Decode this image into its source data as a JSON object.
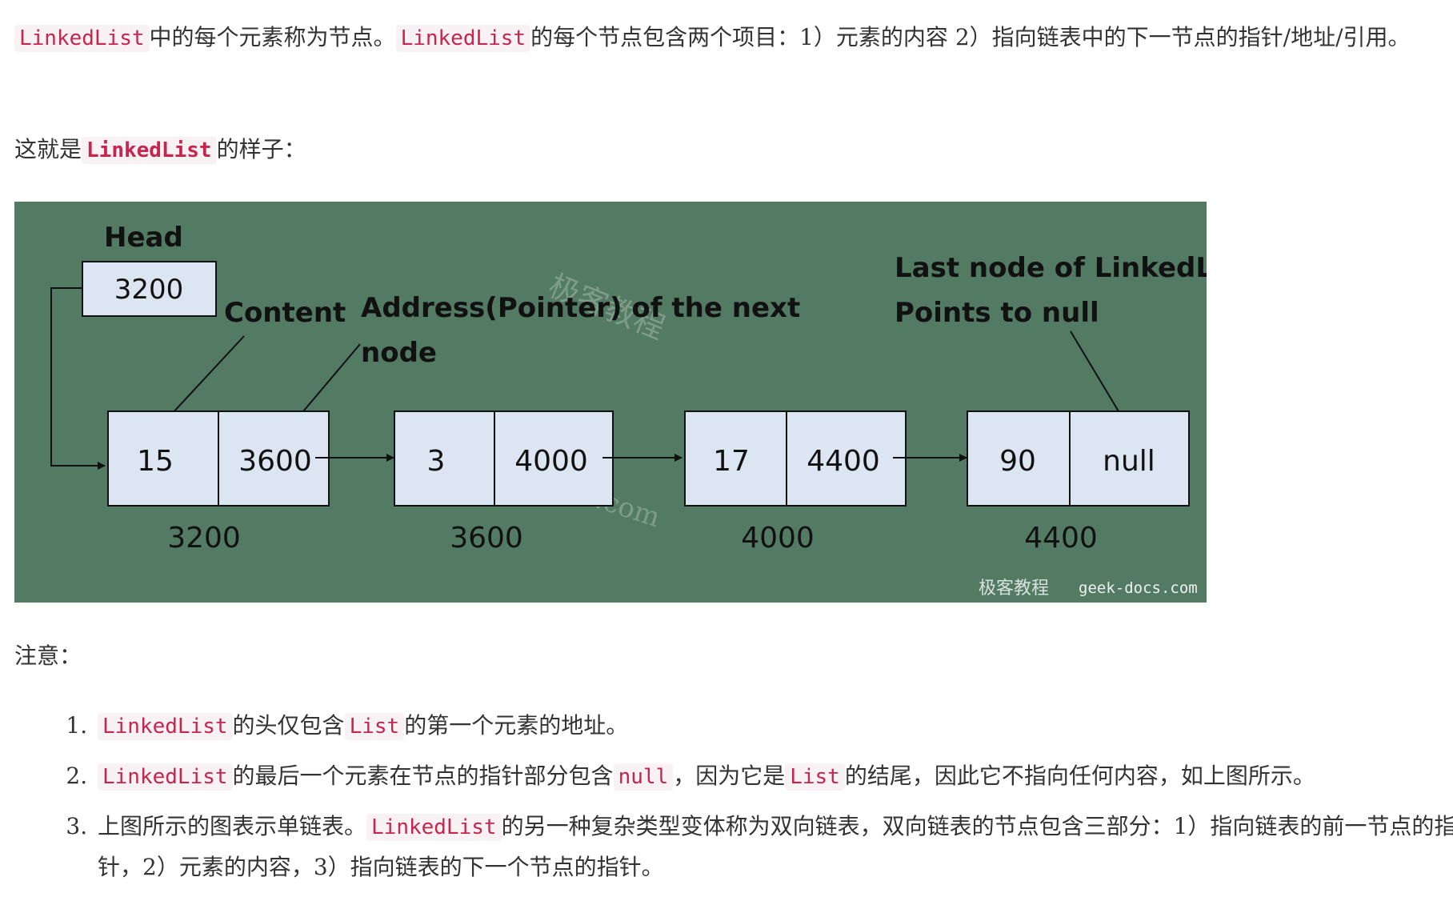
{
  "intro": {
    "code_a": "LinkedList",
    "text_a": "中的每个元素称为节点。",
    "code_b": "LinkedList",
    "text_b": "的每个节点包含两个项目：1）元素的内容 2）指向链表中的下一节点的指针/地址/引用。"
  },
  "example": {
    "text_a": "这就是",
    "code": "LinkedList",
    "text_b": "的样子："
  },
  "diagram": {
    "head_label": "Head",
    "head_value": "3200",
    "content_label": "Content",
    "pointer_label_line1": "Address(Pointer) of the next",
    "pointer_label_line2": "node",
    "last_label_line1": "Last node of LinkedList",
    "last_label_line2": "Points to null",
    "nodes": [
      {
        "value": "15",
        "next": "3600",
        "address": "3200"
      },
      {
        "value": "3",
        "next": "4000",
        "address": "3600"
      },
      {
        "value": "17",
        "next": "4400",
        "address": "4000"
      },
      {
        "value": "90",
        "next": "null",
        "address": "4400"
      }
    ],
    "watermark_center": "极客教程",
    "watermark_url": "geek-docs.com",
    "watermark_footer_cn": "极客教程",
    "watermark_footer_en": "geek-docs.com",
    "colors": {
      "background": "#537a62",
      "node_fill": "#dce5f2",
      "stroke": "#111111"
    }
  },
  "note_heading": "注意：",
  "notes": [
    {
      "code_a": "LinkedList",
      "text_a": "的头仅包含",
      "code_b": "List",
      "text_b": "的第一个元素的地址。"
    },
    {
      "code_a": "LinkedList",
      "text_a": "的最后一个元素在节点的指针部分包含",
      "code_b": "null",
      "text_b": "，因为它是",
      "code_c": "List",
      "text_c": "的结尾，因此它不指向任何内容，如上图所示。"
    },
    {
      "text_pre": "上图所示的图表示单链表。",
      "code_a": "LinkedList",
      "text_a": "的另一种复杂类型变体称为双向链表，双向链表的节点包含三部分：1）指向链表的前一节点的指针，2）元素的内容，3）指向链表的下一个节点的指针。"
    }
  ]
}
